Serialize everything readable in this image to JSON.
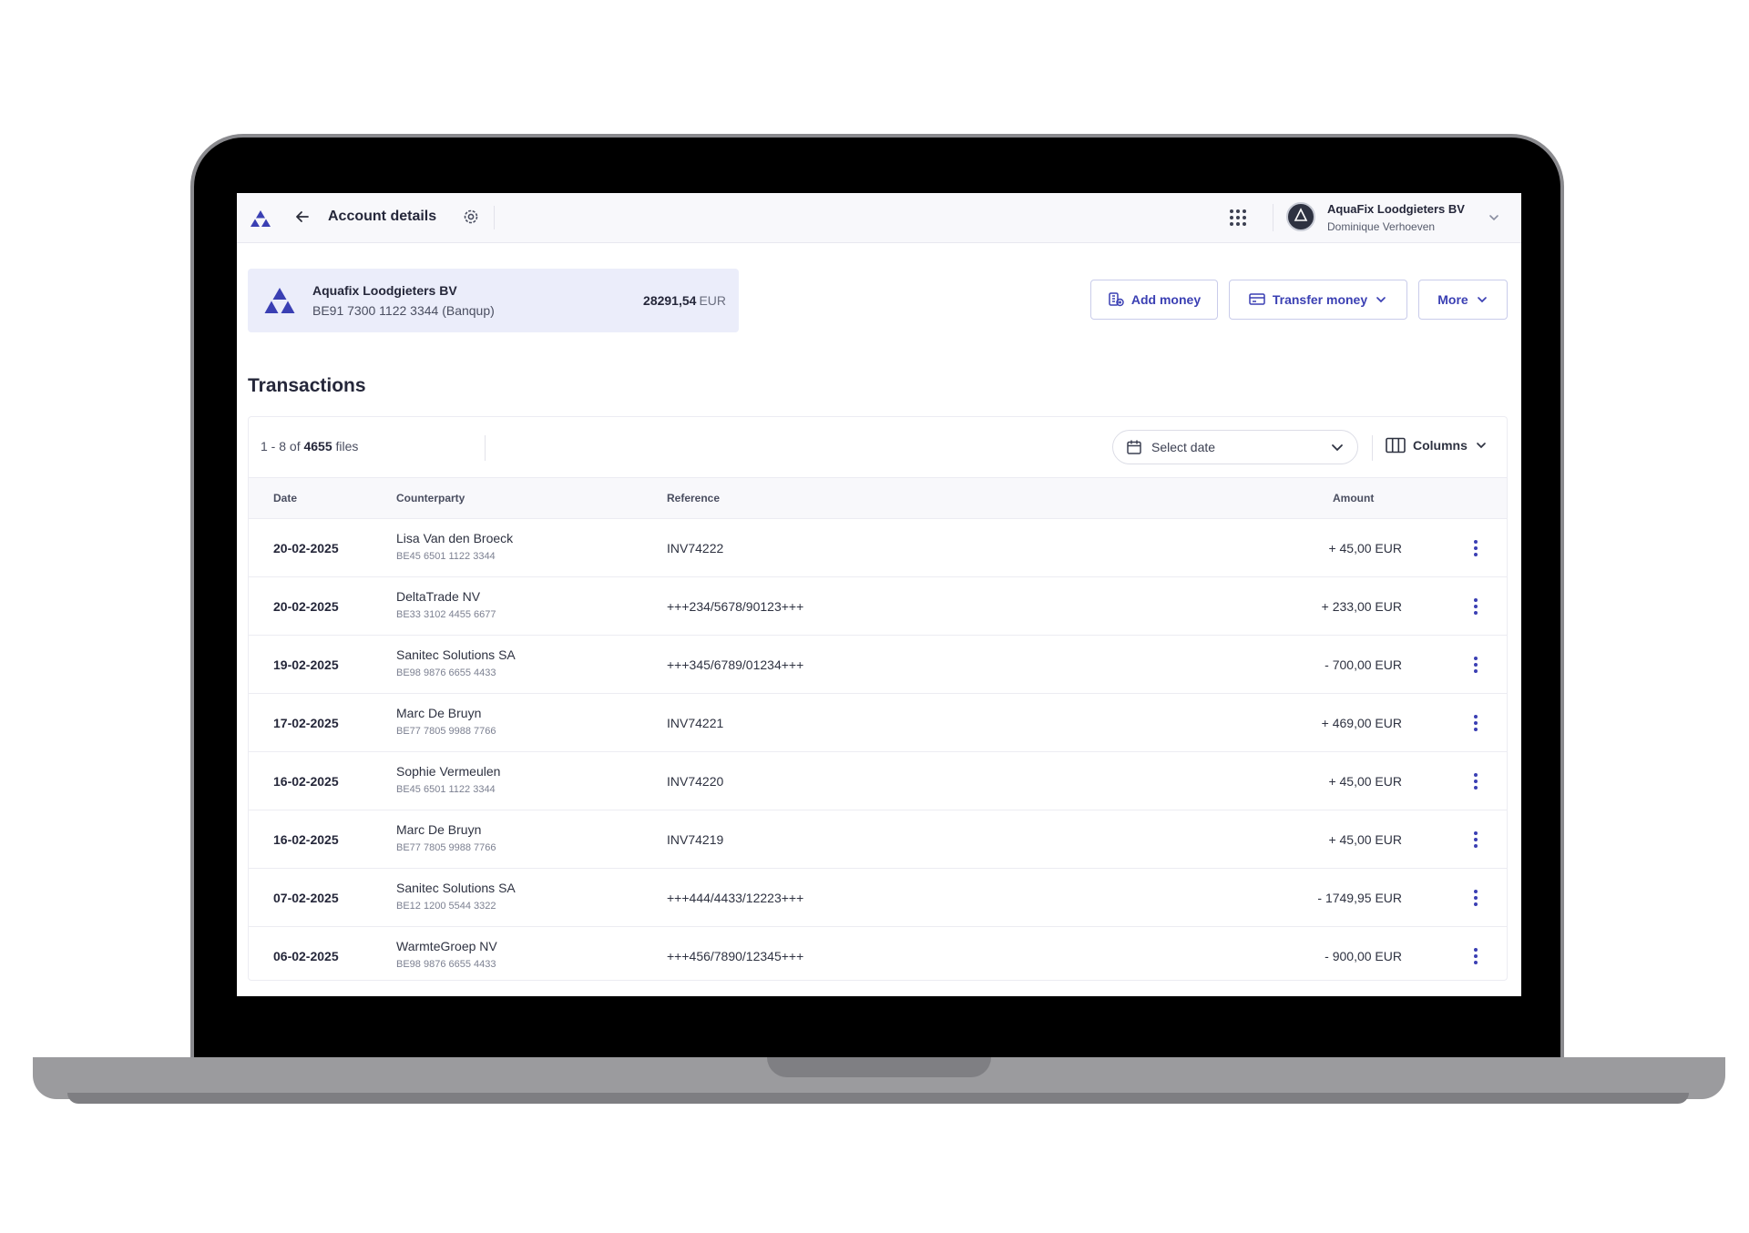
{
  "header": {
    "title": "Account details",
    "user_company": "AquaFix Loodgieters BV",
    "user_name": "Dominique Verhoeven"
  },
  "account": {
    "name": "Aquafix Loodgieters BV",
    "iban": "BE91 7300 1122 3344 (Banqup)",
    "balance": "28291,54",
    "currency": "EUR"
  },
  "actions": {
    "add_money": "Add money",
    "transfer_money": "Transfer money",
    "more": "More"
  },
  "transactions": {
    "title": "Transactions",
    "count_range": "1 - 8",
    "count_of": "of",
    "count_total": "4655",
    "count_unit": "files",
    "date_placeholder": "Select date",
    "columns_label": "Columns",
    "headers": {
      "date": "Date",
      "counterparty": "Counterparty",
      "reference": "Reference",
      "amount": "Amount"
    },
    "rows": [
      {
        "date": "20-02-2025",
        "name": "Lisa Van den Broeck",
        "iban": "BE45 6501 1122 3344",
        "reference": "INV74222",
        "amount": "+ 45,00 EUR"
      },
      {
        "date": "20-02-2025",
        "name": "DeltaTrade NV",
        "iban": "BE33 3102 4455 6677",
        "reference": "+++234/5678/90123+++",
        "amount": "+ 233,00 EUR"
      },
      {
        "date": "19-02-2025",
        "name": "Sanitec Solutions SA",
        "iban": "BE98 9876 6655 4433",
        "reference": "+++345/6789/01234+++",
        "amount": "- 700,00 EUR"
      },
      {
        "date": "17-02-2025",
        "name": "Marc De Bruyn",
        "iban": "BE77 7805 9988 7766",
        "reference": "INV74221",
        "amount": "+ 469,00 EUR"
      },
      {
        "date": "16-02-2025",
        "name": "Sophie Vermeulen",
        "iban": "BE45 6501 1122 3344",
        "reference": "INV74220",
        "amount": "+ 45,00 EUR"
      },
      {
        "date": "16-02-2025",
        "name": "Marc De Bruyn",
        "iban": "BE77 7805 9988 7766",
        "reference": "INV74219",
        "amount": "+ 45,00 EUR"
      },
      {
        "date": "07-02-2025",
        "name": "Sanitec Solutions SA",
        "iban": "BE12 1200 5544 3322",
        "reference": "+++444/4433/12223+++",
        "amount": "- 1749,95 EUR"
      },
      {
        "date": "06-02-2025",
        "name": "WarmteGroep NV",
        "iban": "BE98 9876 6655 4433",
        "reference": "+++456/7890/12345+++",
        "amount": "- 900,00 EUR"
      }
    ]
  },
  "colors": {
    "accent": "#3a3fb3",
    "card_bg": "#ebedfa"
  },
  "icons": {
    "logo": "triangle-logo-icon",
    "back": "arrow-left-icon",
    "settings": "gear-icon",
    "apps": "grid-icon",
    "row_menu": "vertical-dots-icon"
  }
}
